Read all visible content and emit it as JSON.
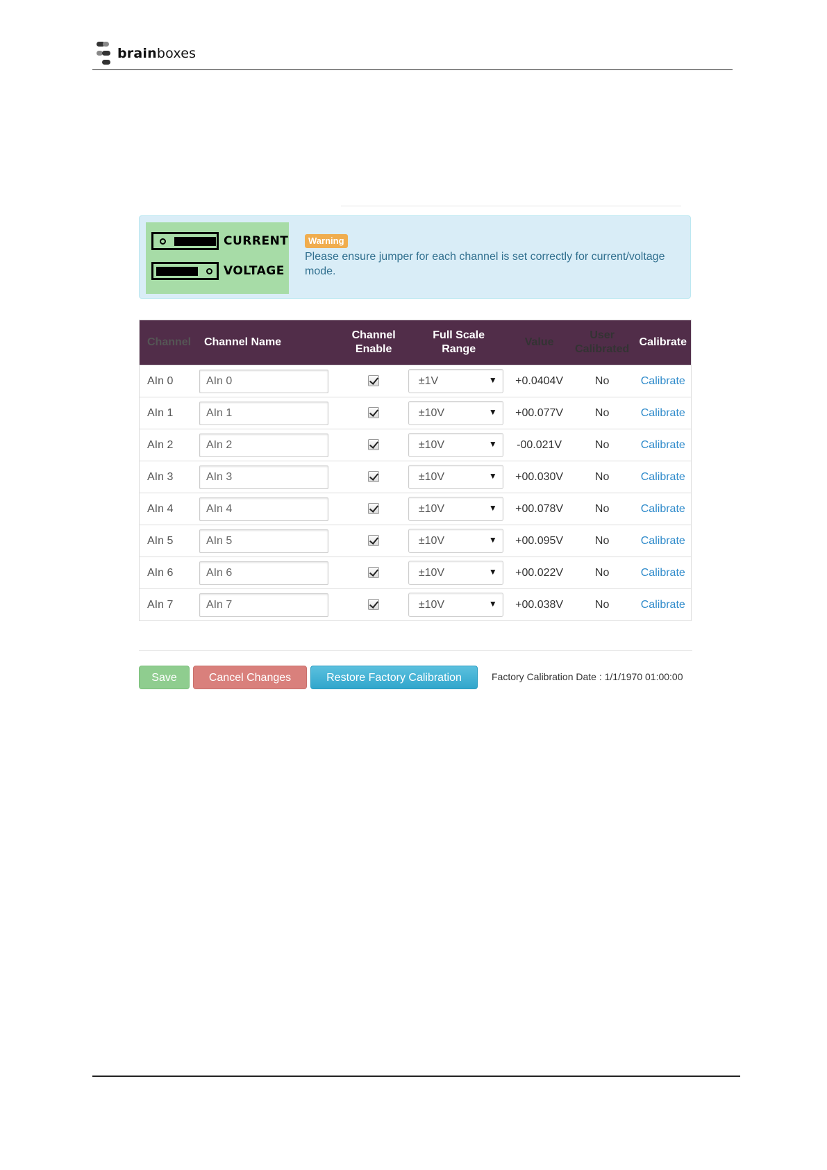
{
  "brand": {
    "name_bold": "brain",
    "name_rest": "boxes"
  },
  "alert": {
    "image_labels": {
      "current": "CURRENT",
      "voltage": "VOLTAGE"
    },
    "badge": "Warning",
    "message": "Please ensure jumper for each channel is set correctly for current/voltage mode."
  },
  "table": {
    "headers": {
      "channel": "Channel",
      "channel_name": "Channel Name",
      "channel_enable_1": "Channel",
      "channel_enable_2": "Enable",
      "range_1": "Full Scale",
      "range_2": "Range",
      "value": "Value",
      "user_cal_1": "User",
      "user_cal_2": "Calibrated",
      "calibrate": "Calibrate"
    },
    "rows": [
      {
        "channel": "AIn 0",
        "name": "AIn 0",
        "enabled": true,
        "range": "±1V",
        "value": "+0.0404V",
        "user_calibrated": "No",
        "action": "Calibrate"
      },
      {
        "channel": "AIn 1",
        "name": "AIn 1",
        "enabled": true,
        "range": "±10V",
        "value": "+00.077V",
        "user_calibrated": "No",
        "action": "Calibrate"
      },
      {
        "channel": "AIn 2",
        "name": "AIn 2",
        "enabled": true,
        "range": "±10V",
        "value": "-00.021V",
        "user_calibrated": "No",
        "action": "Calibrate"
      },
      {
        "channel": "AIn 3",
        "name": "AIn 3",
        "enabled": true,
        "range": "±10V",
        "value": "+00.030V",
        "user_calibrated": "No",
        "action": "Calibrate"
      },
      {
        "channel": "AIn 4",
        "name": "AIn 4",
        "enabled": true,
        "range": "±10V",
        "value": "+00.078V",
        "user_calibrated": "No",
        "action": "Calibrate"
      },
      {
        "channel": "AIn 5",
        "name": "AIn 5",
        "enabled": true,
        "range": "±10V",
        "value": "+00.095V",
        "user_calibrated": "No",
        "action": "Calibrate"
      },
      {
        "channel": "AIn 6",
        "name": "AIn 6",
        "enabled": true,
        "range": "±10V",
        "value": "+00.022V",
        "user_calibrated": "No",
        "action": "Calibrate"
      },
      {
        "channel": "AIn 7",
        "name": "AIn 7",
        "enabled": true,
        "range": "±10V",
        "value": "+00.038V",
        "user_calibrated": "No",
        "action": "Calibrate"
      }
    ]
  },
  "buttons": {
    "save": "Save",
    "cancel": "Cancel Changes",
    "restore": "Restore Factory Calibration"
  },
  "factory_date": "Factory Calibration Date : 1/1/1970 01:00:00",
  "colors": {
    "table_header": "#512d49",
    "alert_bg": "#d9edf7",
    "warning_badge": "#f0ad4e",
    "save_button": "#8fcd8f",
    "cancel_button": "#d9807c",
    "restore_button": "#31a6cc",
    "link": "#2f8bcb"
  }
}
